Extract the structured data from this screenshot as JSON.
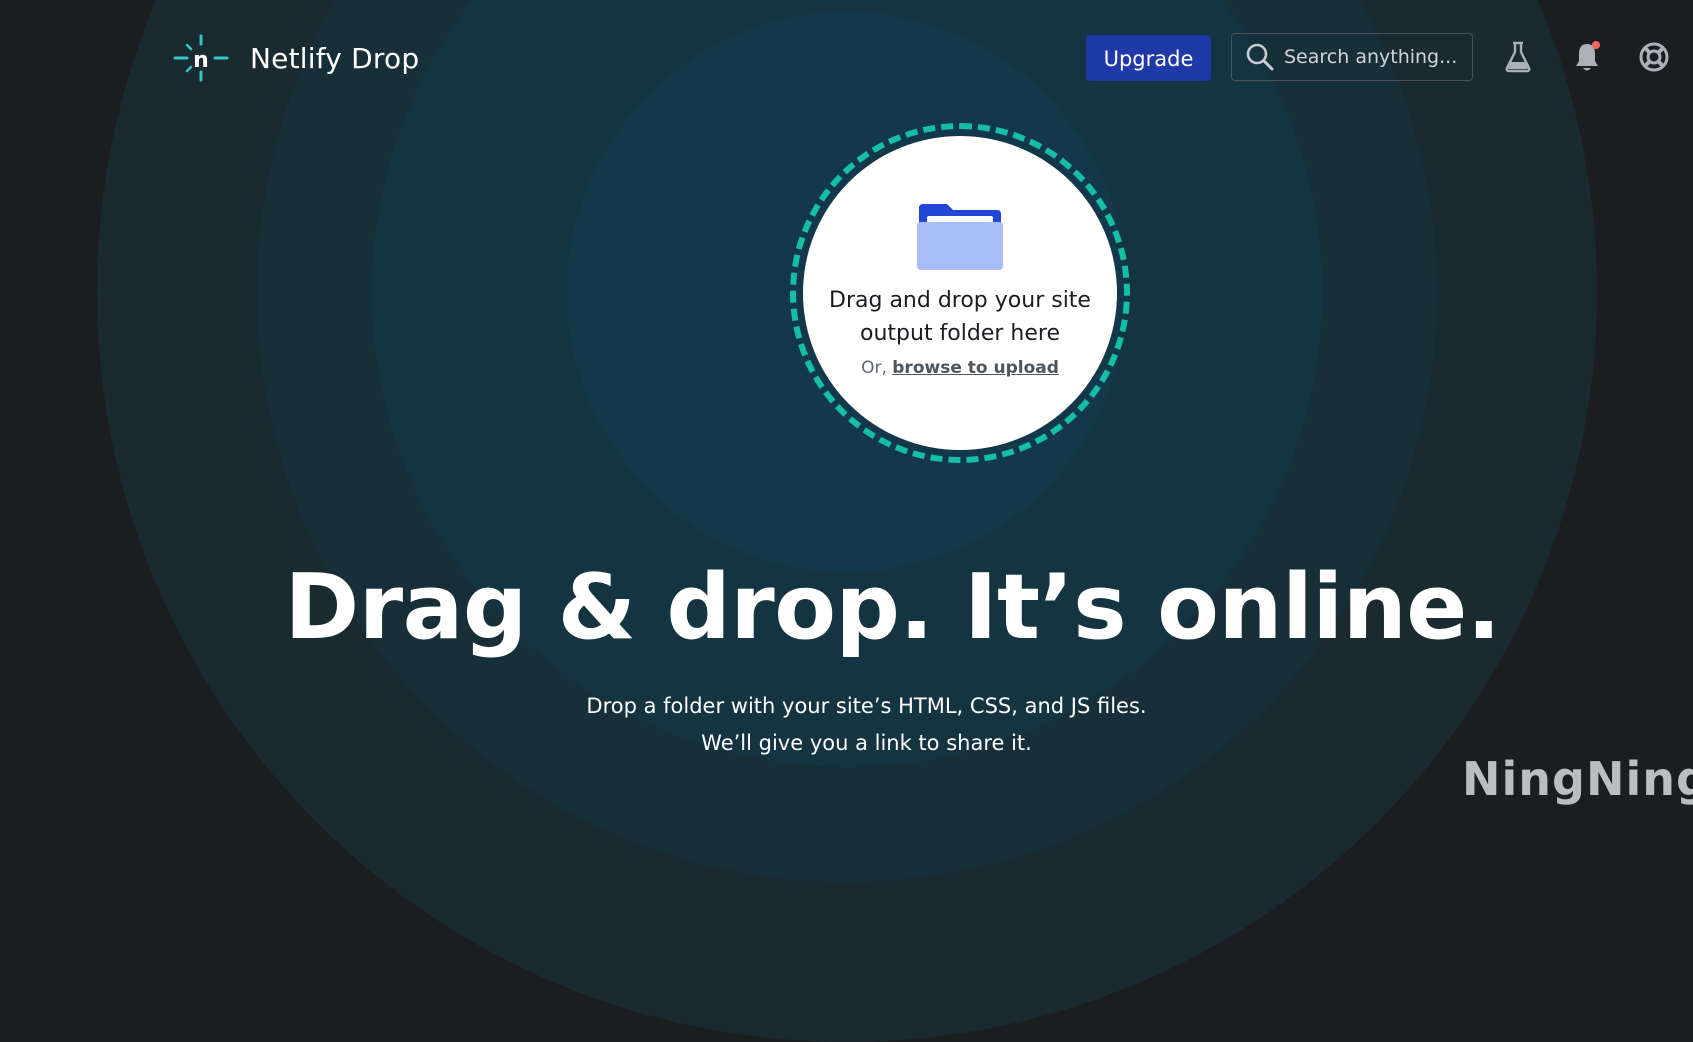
{
  "header": {
    "app_title": "Netlify Drop",
    "upgrade_label": "Upgrade",
    "search_placeholder": "Search anything...",
    "icons": [
      "logo-icon",
      "search-icon",
      "flask-icon",
      "bell-icon",
      "help-icon"
    ]
  },
  "dropzone": {
    "title": "Drag and drop your site output folder here",
    "or_text": "Or,",
    "browse_label": "browse to upload"
  },
  "hero": {
    "title": "Drag & drop. It’s online.",
    "line1": "Drop a folder with your site’s HTML, CSS, and JS files.",
    "line2": "We’ll give you a link to share it."
  },
  "watermark": "NingNing",
  "colors": {
    "background": "#1b1d20",
    "accent": "#14bfa6",
    "upgrade": "#1f3aa8",
    "notification_dot": "#f56565"
  }
}
